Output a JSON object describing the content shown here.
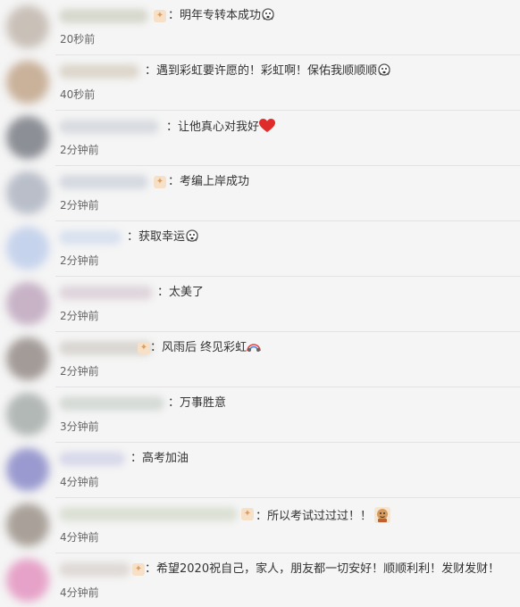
{
  "comments": [
    {
      "prefix": "：",
      "text": "明年专转本成功",
      "emoji": "scared-emoji",
      "time": "20秒前",
      "avatar_color": "#c9c0b8",
      "name_color": "#d6d8cd"
    },
    {
      "prefix": "：",
      "text": "遇到彩虹要许愿的！彩虹啊！保佑我顺顺顺",
      "emoji": "scared-emoji",
      "time": "40秒前",
      "avatar_color": "#c9b19a",
      "name_color": "#dcd6cc"
    },
    {
      "prefix": "：",
      "text": "让他真心对我好",
      "emoji": "heart-emoji",
      "time": "2分钟前",
      "avatar_color": "#8c8f96",
      "name_color": "#d8dbe0"
    },
    {
      "prefix": "：",
      "text": "考编上岸成功",
      "emoji": "",
      "time": "2分钟前",
      "avatar_color": "#b9bec9",
      "name_color": "#d5d9e0"
    },
    {
      "prefix": "：",
      "text": "获取幸运",
      "emoji": "scared-emoji",
      "time": "2分钟前",
      "avatar_color": "#c6d3ec",
      "name_color": "#d9e1ef"
    },
    {
      "prefix": "：",
      "text": "太美了",
      "emoji": "",
      "time": "2分钟前",
      "avatar_color": "#c7b2c6",
      "name_color": "#dfd5dc"
    },
    {
      "prefix": "：",
      "text": "风雨后 终见彩虹",
      "emoji": "rainbow-emoji",
      "time": "2分钟前",
      "avatar_color": "#a39b98",
      "name_color": "#d9d6d2"
    },
    {
      "prefix": "：",
      "text": "万事胜意",
      "emoji": "",
      "time": "3分钟前",
      "avatar_color": "#b2b8b5",
      "name_color": "#d5dad6"
    },
    {
      "prefix": "：",
      "text": "高考加油",
      "emoji": "",
      "time": "4分钟前",
      "avatar_color": "#9a9ad0",
      "name_color": "#d8d9ea"
    },
    {
      "prefix": "：",
      "text": "所以考试过过过！！",
      "emoji": "sticker-emoji",
      "time": "4分钟前",
      "avatar_color": "#a9a199",
      "name_color": "#dbe0d4"
    },
    {
      "prefix": "：",
      "text": "希望2020祝自己，家人，朋友都一切安好！顺顺利利！发财发财！",
      "emoji": "",
      "time": "4分钟前",
      "avatar_color": "#e6a2c8",
      "name_color": "#dfd9d6"
    }
  ]
}
